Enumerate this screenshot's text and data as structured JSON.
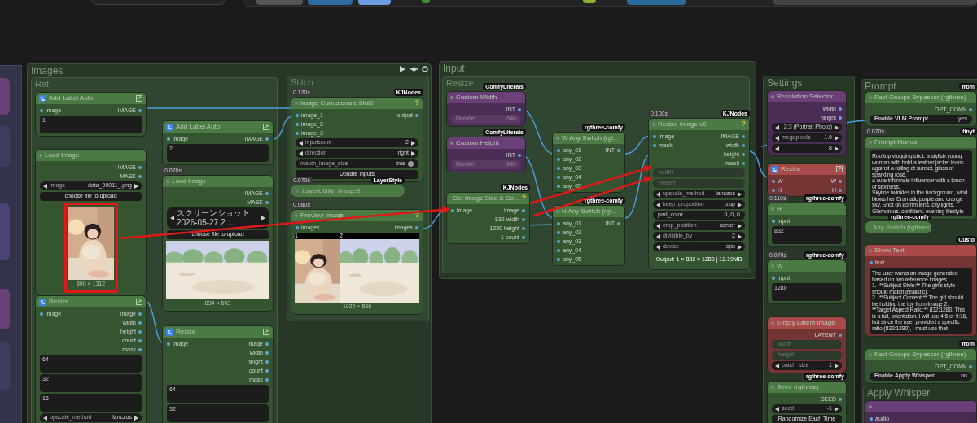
{
  "groups": [
    {
      "title": "Images"
    },
    {
      "title": "Ref"
    },
    {
      "title": "Stitch"
    },
    {
      "title": "Input"
    },
    {
      "title": "Resize"
    },
    {
      "title": "Settings"
    },
    {
      "title": "Prompt"
    },
    {
      "title": "Apply Whisper"
    }
  ],
  "nodes": [
    {
      "title": "Add Label Auto",
      "color": "#4b7a44",
      "icon": true,
      "collapsed": false,
      "inputs": [
        "image"
      ],
      "outputs": [
        "IMAGE"
      ],
      "widgets": [
        {
          "kind": "text",
          "value": "1"
        }
      ]
    },
    {
      "title": "Load Image",
      "color": "#4b7a44",
      "collapsed": false,
      "outputs": [
        "IMAGE",
        "MASK"
      ],
      "widgets": [
        {
          "kind": "combo",
          "label": "image",
          "value": "data_00011_.png"
        },
        {
          "kind": "button",
          "label": "choose file to upload"
        }
      ],
      "preview": {
        "caption": "800 × 1312",
        "highlighted": true
      }
    },
    {
      "title": "Add Label Auto",
      "color": "#4b7a44",
      "icon": true,
      "collapsed": false,
      "inputs": [
        "image"
      ],
      "outputs": [
        "IMAGE"
      ],
      "widgets": [
        {
          "kind": "text",
          "value": "2"
        }
      ]
    },
    {
      "title": "Load Image",
      "color": "#4b7a44",
      "timing": "0.070s",
      "collapsed": false,
      "outputs": [
        "IMAGE",
        "MASK"
      ],
      "widgets": [
        {
          "kind": "combo",
          "value": "スクリーンショット 2026-05-27 2 ..."
        },
        {
          "kind": "button",
          "label": "choose file to upload"
        }
      ],
      "preview": {
        "caption": "834 × 603",
        "highlighted": false
      }
    },
    {
      "title": "Resize",
      "color": "#4b7a44",
      "icon": true,
      "collapsed": false,
      "inputs": [
        "image"
      ],
      "outputs": [
        "image",
        "width",
        "height",
        "count",
        "mask"
      ],
      "widgets": [
        {
          "kind": "text",
          "value": "64"
        },
        {
          "kind": "text",
          "value": "32"
        },
        {
          "kind": "text",
          "value": "16"
        },
        {
          "kind": "combo",
          "label": "upscale_method",
          "value": "lanczos"
        }
      ]
    },
    {
      "title": "Resize",
      "color": "#4b7a44",
      "icon": true,
      "collapsed": false,
      "inputs": [
        "image"
      ],
      "outputs": [
        "image",
        "width",
        "height",
        "count",
        "mask"
      ],
      "widgets": [
        {
          "kind": "text",
          "value": "64"
        },
        {
          "kind": "text",
          "value": "32"
        }
      ]
    },
    {
      "title": "Image Concatenate Multi",
      "color": "#4b7a44",
      "timing": "0.120s",
      "badge": "KJNodes",
      "help": "?",
      "collapsed": false,
      "inputs": [
        "image_1",
        "image_2",
        "image_3"
      ],
      "outputs": [
        "output"
      ],
      "widgets": [
        {
          "kind": "combo",
          "label": "inputcount",
          "value": "2"
        },
        {
          "kind": "combo",
          "label": "direction",
          "value": "right"
        },
        {
          "kind": "switch",
          "label": "match_image_size",
          "value": "true"
        },
        {
          "kind": "button",
          "label": "Update inputs"
        }
      ]
    },
    {
      "title": "LayerUtility: ImageS",
      "color": "#4b7a44",
      "timing": "0.070s",
      "badge": "LayerStyle",
      "collapsed": true
    },
    {
      "title": "Preview Image",
      "color": "#4b7a44",
      "timing": "0.080s",
      "help": "?",
      "collapsed": false,
      "inputs": [
        "images"
      ],
      "outputs": [
        "images"
      ],
      "preview": {
        "labels": [
          "1",
          "2"
        ],
        "caption": "1024 × 536",
        "highlighted": false
      }
    },
    {
      "title": "Custom Width",
      "color": "#6b3f78",
      "badge": "ComfyLiterals",
      "collapsed": false,
      "outputs": [
        "INT"
      ],
      "widgets": [
        {
          "kind": "number",
          "label": "Number",
          "value": "640"
        }
      ]
    },
    {
      "title": "Custom Height",
      "color": "#6b3f78",
      "badge": "ComfyLiterals",
      "collapsed": false,
      "outputs": [
        "INT"
      ],
      "widgets": [
        {
          "kind": "number",
          "label": "Number",
          "value": "640"
        }
      ]
    },
    {
      "title": "Get Image Size & Co...",
      "color": "#4b7a44",
      "badge": "KJNodes",
      "help": "?",
      "collapsed": false,
      "inputs": [
        "image"
      ],
      "outputs": [
        "image",
        "832 width",
        "1280 height",
        "1 count"
      ]
    },
    {
      "title": "W Any Switch (rgt...",
      "color": "#4b7a44",
      "badge": "rgthree-comfy",
      "collapsed": false,
      "inputs": [
        "any_01",
        "any_02",
        "any_03",
        "any_04",
        "any_05"
      ],
      "outputs": [
        "INT"
      ]
    },
    {
      "title": "H Any Switch (rgt...",
      "color": "#4b7a44",
      "badge": "rgthree-comfy",
      "collapsed": false,
      "inputs": [
        "any_01",
        "any_02",
        "any_03",
        "any_04",
        "any_05"
      ],
      "outputs": [
        "INT"
      ]
    },
    {
      "title": "Resize Image v2",
      "color": "#4b7a44",
      "timing": "0.100s",
      "badge": "KJNodes",
      "help": "?",
      "collapsed": false,
      "inputs": [
        "image",
        "mask"
      ],
      "outputs": [
        "IMAGE",
        "width",
        "height",
        "mask"
      ],
      "widgets": [
        {
          "kind": "disabled",
          "label": "width"
        },
        {
          "kind": "disabled",
          "label": "height"
        },
        {
          "kind": "combo",
          "label": "upscale_method",
          "value": "lanczos"
        },
        {
          "kind": "combo",
          "label": "keep_proportion",
          "value": "crop"
        },
        {
          "kind": "string",
          "label": "pad_color",
          "value": "0, 0, 0"
        },
        {
          "kind": "combo",
          "label": "crop_position",
          "value": "center"
        },
        {
          "kind": "combo",
          "label": "divisible_by",
          "value": "2"
        },
        {
          "kind": "combo",
          "label": "device",
          "value": "cpu"
        },
        {
          "kind": "info",
          "value": "Output: 1 × 832 × 1280 | 12.19MB"
        }
      ]
    },
    {
      "title": "Resolution Selector",
      "color": "#6b3f78",
      "collapsed": false,
      "outputs": [
        "width",
        "height"
      ],
      "widgets": [
        {
          "kind": "combo",
          "value": "2:3 (Portrait Photo)"
        },
        {
          "kind": "combo",
          "label": "megapixels",
          "value": "1.0"
        },
        {
          "kind": "combo",
          "value": "8"
        }
      ]
    },
    {
      "title": "Resize",
      "color": "#a84a4a",
      "icon": true,
      "collapsed": false,
      "inputs": [
        "W",
        "H"
      ],
      "outputs": [
        "W",
        "H"
      ]
    },
    {
      "title": "H",
      "color": "#4b7a44",
      "timing": "0.110s",
      "badge": "rgthree-comfy",
      "collapsed": false,
      "inputs": [
        "input"
      ],
      "widgets": [
        {
          "kind": "text",
          "value": "832"
        }
      ]
    },
    {
      "title": "W",
      "color": "#4b7a44",
      "timing": "0.070s",
      "badge": "rgthree-comfy",
      "collapsed": false,
      "inputs": [
        "input"
      ],
      "widgets": [
        {
          "kind": "text",
          "value": "1280"
        }
      ]
    },
    {
      "title": "Empty Latent Image",
      "color": "#a84a4a",
      "collapsed": false,
      "outputs": [
        "LATENT"
      ],
      "widgets": [
        {
          "kind": "disabled",
          "label": "width"
        },
        {
          "kind": "disabled",
          "label": "height"
        },
        {
          "kind": "combo",
          "label": "batch_size",
          "value": "1"
        }
      ]
    },
    {
      "title": "Seed (rgthree)",
      "color": "#4b7a44",
      "badge": "rgthree-comfy",
      "collapsed": false,
      "outputs": [
        "SEED"
      ],
      "widgets": [
        {
          "kind": "combo",
          "label": "seed",
          "value": "-1"
        },
        {
          "kind": "button",
          "label": "Randomize Each Time"
        }
      ]
    },
    {
      "title": "Fast Groups Bypasser (rgthree)",
      "color": "#4b7a44",
      "badge": "from",
      "collapsed": false,
      "outputs": [
        "OPT_CONN"
      ],
      "widgets": [
        {
          "kind": "toggle",
          "label": "Enable VLM Prompt",
          "value": "yes"
        }
      ]
    },
    {
      "title": "Prompt Manual",
      "color": "#4b7a44",
      "timing": "0.070s",
      "badge": "tinyt",
      "collapsed": false,
      "widgets": [
        {
          "kind": "longtext",
          "value": "Rooftop vlogging shot: a stylish young woman with bold a leather jacket leans against a railing at sunset, glass of sparkling rosé.\na cute informale influencer with a touch of sexiness.\nSkyline twinkles in the background, wind blows her Dramatic purple and orange sky. Shot on 85mm lens, city lights. Glamorous, confident, evening lifestyle"
        }
      ]
    },
    {
      "title": "Any Switch (rgthree)",
      "color": "#4b7a44",
      "badge": "rgthree-comfy",
      "collapsed": true
    },
    {
      "title": "Show Text",
      "color": "#a84a4a",
      "badge": "Custo",
      "collapsed": false,
      "inputs": [
        "text"
      ],
      "widgets": [
        {
          "kind": "longtext",
          "value": "The user wants an image generated based on two reference images.\n1.  **Subject Style:** The girl's style should match (realistic).\n2.  **Subject Content:** The girl should be holding the toy from Image 2.\n**Target Aspect Ratio:** 832:1280. This is a tall, orientation. I will use 4:5 or 9:16, but since the user provided a specific ratio (832:1280), I must use that"
        }
      ]
    },
    {
      "title": "Fast Groups Bypasser (rgthree)",
      "color": "#4b7a44",
      "badge": "from",
      "collapsed": false,
      "outputs": [
        "OPT_CONN"
      ],
      "widgets": [
        {
          "kind": "toggle",
          "label": "Enable Apply Whisper",
          "value": "no"
        }
      ]
    },
    {
      "color": "#6b3f78",
      "collapsed": false,
      "inputs": [
        "audio"
      ]
    }
  ]
}
